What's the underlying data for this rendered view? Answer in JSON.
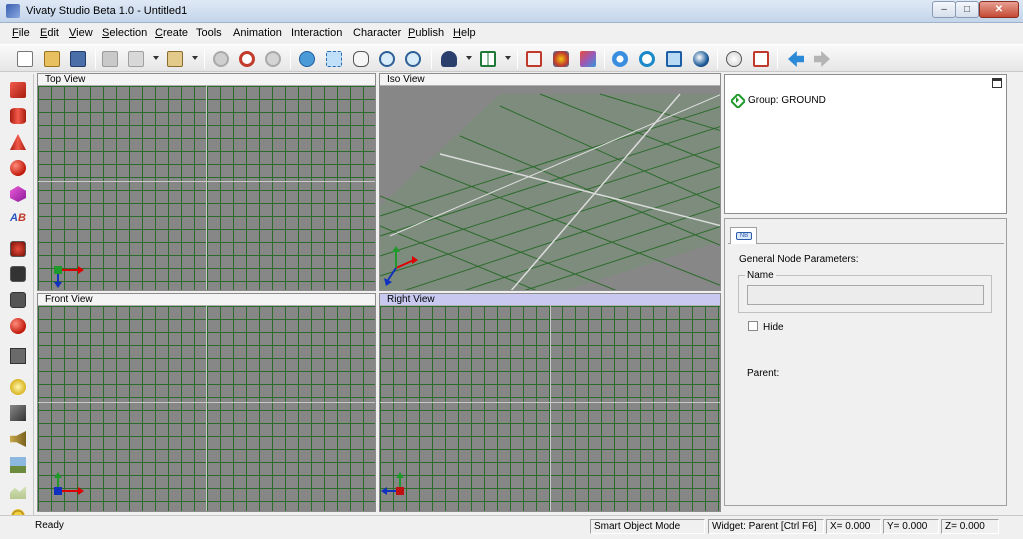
{
  "window": {
    "title": "Vivaty Studio Beta 1.0 - Untitled1",
    "min_label": "–",
    "max_label": "□",
    "close_label": "✕"
  },
  "menu": [
    {
      "mn": "F",
      "rest": "ile"
    },
    {
      "mn": "E",
      "rest": "dit"
    },
    {
      "mn": "V",
      "rest": "iew"
    },
    {
      "mn": "S",
      "rest": "election"
    },
    {
      "mn": "C",
      "rest": "reate"
    },
    {
      "mn": "",
      "rest": "Tools"
    },
    {
      "mn": "",
      "rest": "Animation"
    },
    {
      "mn": "",
      "rest": "Interaction"
    },
    {
      "mn": "",
      "rest": "Character"
    },
    {
      "mn": "P",
      "rest": "ublish"
    },
    {
      "mn": "H",
      "rest": "elp"
    }
  ],
  "toolbar_icons": [
    "new-file-icon",
    "open-folder-icon",
    "save-icon",
    "cut-icon",
    "copy-icon",
    "paste-icon",
    "undo-icon",
    "redo-icon",
    "repeat-icon",
    "navigate-icon",
    "zoom-region-icon",
    "pan-hand-icon",
    "zoom-in-icon",
    "zoom-out-icon",
    "avatar-icon",
    "layout-grid-icon",
    "render-icon",
    "materials-icon",
    "objects-icon",
    "move-icon",
    "rotate-icon",
    "scale-icon",
    "sphere-icon",
    "light-bulb-icon",
    "publish-icon",
    "back-arrow-icon",
    "forward-arrow-icon"
  ],
  "left_tools": [
    "box-icon",
    "cylinder-icon",
    "cone-icon",
    "sphere-icon",
    "polyhedron-icon",
    "text-abc-icon",
    "group-red-icon",
    "group-dark-icon",
    "group-gray-icon",
    "red-ball-icon",
    "group-tree-icon",
    "light-icon",
    "spotlight-icon",
    "sound-icon",
    "background-icon",
    "terrain-icon",
    "sun-gear-icon"
  ],
  "viewports": {
    "top": "Top View",
    "iso": "Iso View",
    "front": "Front View",
    "right": "Right View"
  },
  "tree": {
    "item_label": "Group:  GROUND"
  },
  "props": {
    "tab_icon_text": "NB",
    "title": "General Node Parameters:",
    "name_label": "Name",
    "name_value": "",
    "hide_label": "Hide",
    "hide_checked": false,
    "parent_label": "Parent:"
  },
  "status": {
    "ready": "Ready",
    "mode": "Smart Object Mode",
    "widget": "Widget: Parent [Ctrl F6]",
    "x": "X=  0.000",
    "y": "Y=  0.000",
    "z": "Z=  0.000"
  },
  "colors": {
    "grid_line": "#2d6b2d",
    "viewport_bg": "#878787",
    "active_header": "#c8c8f0"
  }
}
